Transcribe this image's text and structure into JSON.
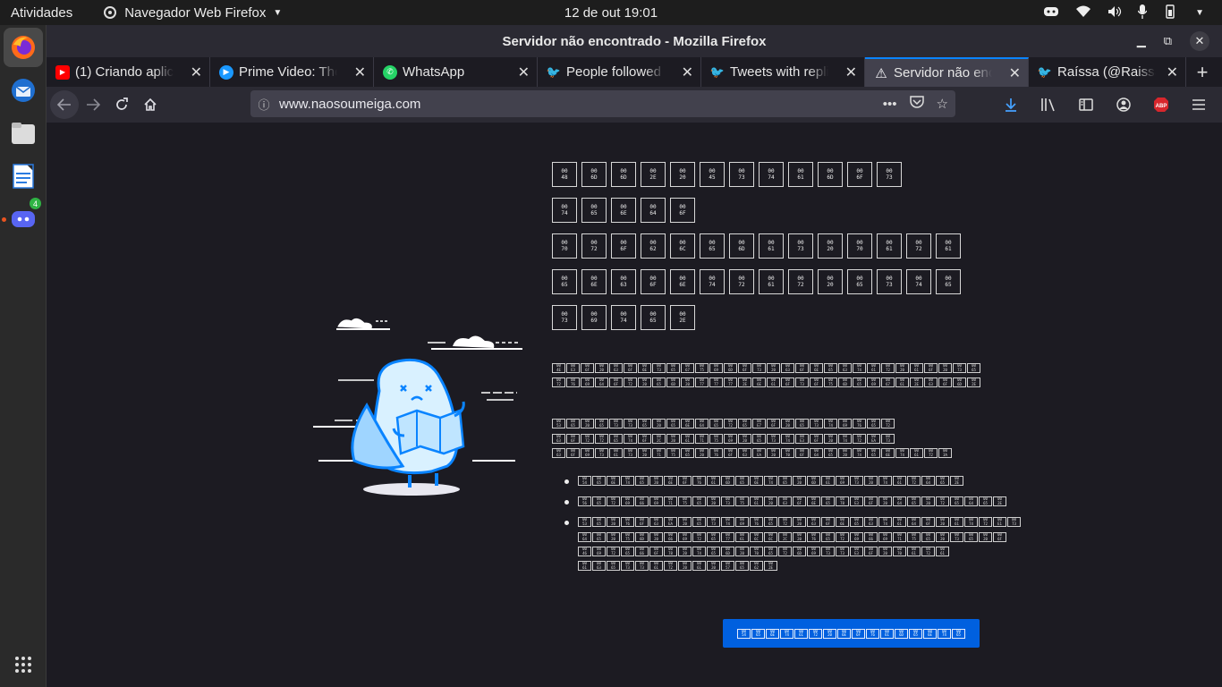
{
  "topbar": {
    "activities": "Atividades",
    "app_name": "Navegador Web Firefox",
    "clock": "12 de out  19:01"
  },
  "dock": {
    "items": [
      "firefox",
      "thunderbird",
      "files",
      "libreoffice-writer",
      "discord"
    ],
    "discord_badge": "4"
  },
  "window": {
    "title": "Servidor não encontrado - Mozilla Firefox"
  },
  "tabs": [
    {
      "label": "(1) Criando aplicati",
      "favicon": "youtube",
      "color": "#ff0000"
    },
    {
      "label": "Prime Video: The G",
      "favicon": "prime-video",
      "color": "#1a98ff"
    },
    {
      "label": "WhatsApp",
      "favicon": "whatsapp",
      "color": "#25d366"
    },
    {
      "label": "People followed by",
      "favicon": "twitter",
      "color": "#1d9bf0"
    },
    {
      "label": "Tweets with replies",
      "favicon": "twitter",
      "color": "#1d9bf0"
    },
    {
      "label": "Servidor não encon",
      "favicon": "warning",
      "color": "#fbfbfe",
      "active": true
    },
    {
      "label": "Raíssa (@Raissasan",
      "favicon": "twitter",
      "color": "#1d9bf0"
    }
  ],
  "urlbar": {
    "url": "www.naosoumeiga.com"
  },
  "error_page": {
    "title_lines": [
      [
        "48",
        "6D",
        "6D",
        "2E",
        "20",
        "45",
        "73",
        "74",
        "61",
        "6D",
        "6F",
        "73"
      ],
      [
        "74",
        "65",
        "6E",
        "64",
        "6F"
      ],
      [
        "70",
        "72",
        "6F",
        "62",
        "6C",
        "65",
        "6D",
        "61",
        "73",
        "20",
        "70",
        "61",
        "72",
        "61"
      ],
      [
        "65",
        "6E",
        "63",
        "6F",
        "6E",
        "74",
        "72",
        "61",
        "72",
        "20",
        "65",
        "73",
        "74",
        "65"
      ],
      [
        "73",
        "69",
        "74",
        "65",
        "2E"
      ]
    ],
    "desc_lines": [
      [
        "4E",
        "E3",
        "6F",
        "20",
        "63",
        "6F",
        "6E",
        "73",
        "65",
        "67",
        "75",
        "69",
        "6D",
        "6F",
        "73",
        "20",
        "63",
        "6F",
        "6E",
        "65",
        "63",
        "74",
        "61",
        "72",
        "20",
        "61",
        "6F",
        "20",
        "73",
        "65"
      ],
      [
        "72",
        "76",
        "69",
        "64",
        "6F",
        "72",
        "20",
        "65",
        "6D",
        "20",
        "77",
        "77",
        "77",
        "2E",
        "6E",
        "61",
        "6F",
        "73",
        "6F",
        "75",
        "6D",
        "65",
        "69",
        "67",
        "61",
        "2E",
        "63",
        "6F",
        "6D",
        "2E"
      ]
    ],
    "intro_lines": [
      [
        "53",
        "65",
        "20",
        "65",
        "73",
        "73",
        "65",
        "20",
        "65",
        "6E",
        "64",
        "65",
        "72",
        "65",
        "E7",
        "6F",
        "20",
        "65",
        "73",
        "74",
        "69",
        "76",
        "65",
        "72"
      ],
      [
        "63",
        "6F",
        "72",
        "72",
        "65",
        "74",
        "6F",
        "2C",
        "20",
        "61",
        "71",
        "75",
        "69",
        "20",
        "65",
        "73",
        "74",
        "E3",
        "6F",
        "20",
        "74",
        "72",
        "EA",
        "73"
      ],
      [
        "63",
        "6F",
        "69",
        "73",
        "61",
        "73",
        "20",
        "71",
        "75",
        "65",
        "20",
        "76",
        "6F",
        "63",
        "EA",
        "20",
        "70",
        "6F",
        "64",
        "65",
        "20",
        "74",
        "65",
        "6E",
        "74",
        "61",
        "72",
        "3A"
      ]
    ],
    "bullets": [
      [
        [
          "54",
          "65",
          "6E",
          "74",
          "65",
          "20",
          "6E",
          "6F",
          "76",
          "61",
          "6D",
          "65",
          "6E",
          "74",
          "65",
          "20",
          "6D",
          "61",
          "69",
          "73",
          "20",
          "74",
          "61",
          "72",
          "64",
          "65",
          "2E"
        ]
      ],
      [
        [
          "56",
          "65",
          "72",
          "69",
          "66",
          "69",
          "71",
          "75",
          "65",
          "20",
          "73",
          "75",
          "61",
          "20",
          "63",
          "6F",
          "6E",
          "65",
          "78",
          "E3",
          "6F",
          "20",
          "64",
          "65",
          "20",
          "72",
          "65",
          "64",
          "65",
          "2E"
        ]
      ],
      [
        [
          "53",
          "65",
          "20",
          "76",
          "6F",
          "63",
          "EA",
          "20",
          "65",
          "73",
          "74",
          "69",
          "76",
          "65",
          "72",
          "20",
          "63",
          "6F",
          "6E",
          "65",
          "63",
          "74",
          "61",
          "64",
          "6F",
          "20",
          "61",
          "74",
          "72",
          "E1",
          "73"
        ],
        [
          "64",
          "65",
          "20",
          "75",
          "6D",
          "20",
          "66",
          "69",
          "72",
          "65",
          "77",
          "61",
          "6C",
          "6C",
          "2C",
          "20",
          "76",
          "65",
          "72",
          "69",
          "66",
          "69",
          "71",
          "75",
          "65",
          "20",
          "73",
          "65",
          "20",
          "6F"
        ],
        [
          "46",
          "69",
          "72",
          "65",
          "66",
          "6F",
          "78",
          "20",
          "74",
          "65",
          "6D",
          "20",
          "70",
          "65",
          "72",
          "6D",
          "69",
          "73",
          "73",
          "E3",
          "6F",
          "20",
          "70",
          "61",
          "72",
          "61"
        ],
        [
          "61",
          "63",
          "65",
          "73",
          "73",
          "61",
          "72",
          "20",
          "61",
          "20",
          "57",
          "65",
          "62",
          "2E"
        ]
      ]
    ],
    "button_hex": [
      "54",
      "65",
      "6E",
      "74",
      "61",
      "72",
      "20",
      "6E",
      "6F",
      "76",
      "61",
      "6D",
      "65",
      "6E",
      "74",
      "65"
    ]
  }
}
